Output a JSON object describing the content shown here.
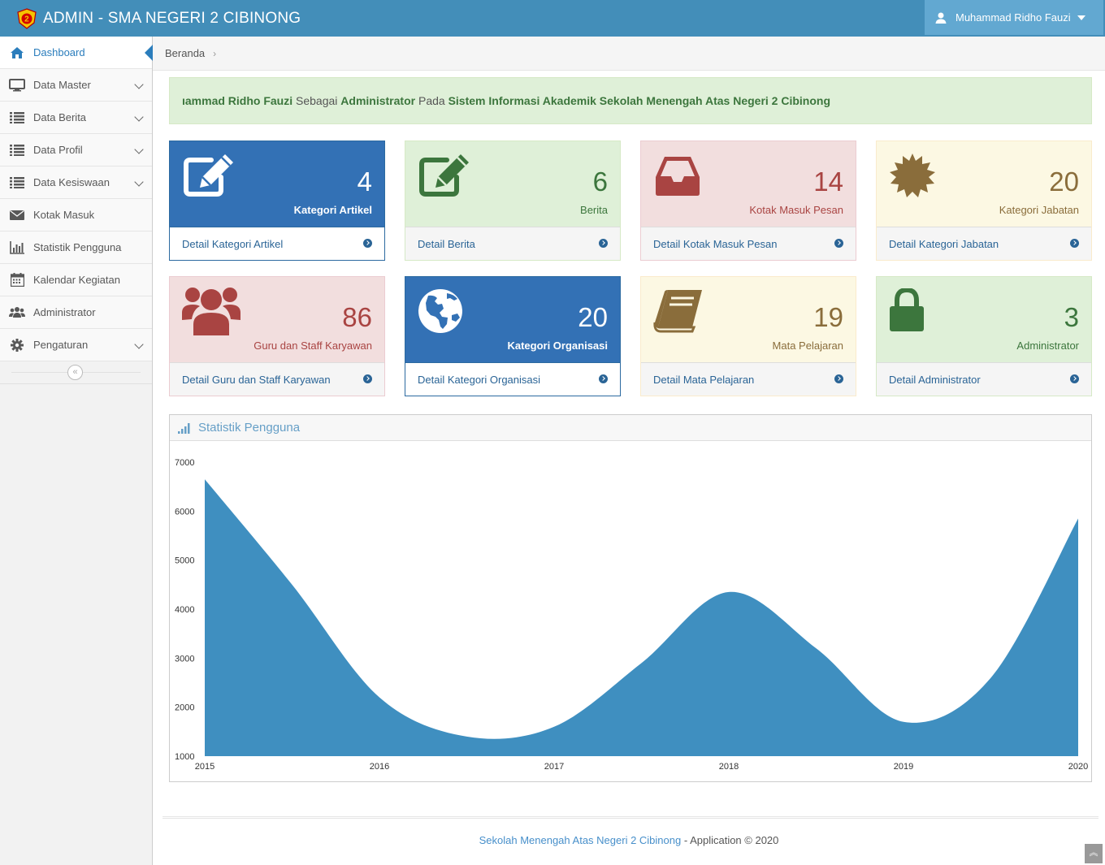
{
  "header": {
    "title": "ADMIN - SMA NEGERI 2 CIBINONG",
    "user_name": "Muhammad Ridho Fauzi"
  },
  "sidebar": {
    "items": [
      {
        "label": "Dashboard",
        "icon": "home-icon",
        "active": true,
        "has_submenu": false
      },
      {
        "label": "Data Master",
        "icon": "desktop-icon",
        "has_submenu": true
      },
      {
        "label": "Data Berita",
        "icon": "list-icon",
        "has_submenu": true
      },
      {
        "label": "Data Profil",
        "icon": "list-icon",
        "has_submenu": true
      },
      {
        "label": "Data Kesiswaan",
        "icon": "list-icon",
        "has_submenu": true
      },
      {
        "label": "Kotak Masuk",
        "icon": "envelope-icon",
        "has_submenu": false
      },
      {
        "label": "Statistik Pengguna",
        "icon": "bar-chart-icon",
        "has_submenu": false
      },
      {
        "label": "Kalendar Kegiatan",
        "icon": "calendar-icon",
        "has_submenu": false
      },
      {
        "label": "Administrator",
        "icon": "users-icon",
        "has_submenu": false
      },
      {
        "label": "Pengaturan",
        "icon": "cog-icon",
        "has_submenu": true
      }
    ],
    "collapse_glyph": "«"
  },
  "breadcrumb": {
    "current": "Beranda",
    "separator": "›"
  },
  "alert": {
    "name": "ıammad Ridho Fauzi",
    "t1": " Sebagai ",
    "role": "Administrator",
    "t2": " Pada ",
    "system": "Sistem Informasi Akademik Sekolah Menengah Atas Negeri 2 Cibinong"
  },
  "stats": [
    {
      "value": "4",
      "label": "Kategori Artikel",
      "link": "Detail Kategori Artikel",
      "color": "blue",
      "icon": "edit-icon"
    },
    {
      "value": "6",
      "label": "Berita",
      "link": "Detail Berita",
      "color": "green",
      "icon": "edit-icon"
    },
    {
      "value": "14",
      "label": "Kotak Masuk Pesan",
      "link": "Detail Kotak Masuk Pesan",
      "color": "red",
      "icon": "inbox-icon"
    },
    {
      "value": "20",
      "label": "Kategori Jabatan",
      "link": "Detail Kategori Jabatan",
      "color": "yellow",
      "icon": "certificate-icon"
    },
    {
      "value": "86",
      "label": "Guru dan Staff Karyawan",
      "link": "Detail Guru dan Staff Karyawan",
      "color": "red",
      "icon": "group-icon"
    },
    {
      "value": "20",
      "label": "Kategori Organisasi",
      "link": "Detail Kategori Organisasi",
      "color": "blue",
      "icon": "globe-icon"
    },
    {
      "value": "19",
      "label": "Mata Pelajaran",
      "link": "Detail Mata Pelajaran",
      "color": "yellow",
      "icon": "book-icon"
    },
    {
      "value": "3",
      "label": "Administrator",
      "link": "Detail Administrator",
      "color": "green",
      "icon": "lock-icon"
    }
  ],
  "widget": {
    "title": "Statistik Pengguna"
  },
  "chart_data": {
    "type": "area",
    "title": "",
    "xlabel": "",
    "ylabel": "",
    "x": [
      2015,
      2015.5,
      2016,
      2016.5,
      2017,
      2017.5,
      2018,
      2018.5,
      2019,
      2019.5,
      2020
    ],
    "y": [
      6650,
      4500,
      2200,
      1400,
      1600,
      2900,
      4350,
      3200,
      1700,
      2600,
      5850
    ],
    "x_ticks": [
      "2015",
      "2016",
      "2017",
      "2018",
      "2019",
      "2020"
    ],
    "y_ticks": [
      "7000",
      "6000",
      "5000",
      "4000",
      "3000",
      "2000",
      "1000"
    ],
    "ylim": [
      1000,
      7000
    ],
    "xlim": [
      2015,
      2020
    ],
    "grid": false,
    "fill_color": "#3f8fc0"
  },
  "footer": {
    "brand": "Sekolah Menengah Atas Negeri 2 Cibinong",
    "rest": " - Application © 2020",
    "scroll_top_glyph": "︽"
  },
  "colors": {
    "navbar": "#438eb9",
    "accent": "#2b7dbc"
  }
}
